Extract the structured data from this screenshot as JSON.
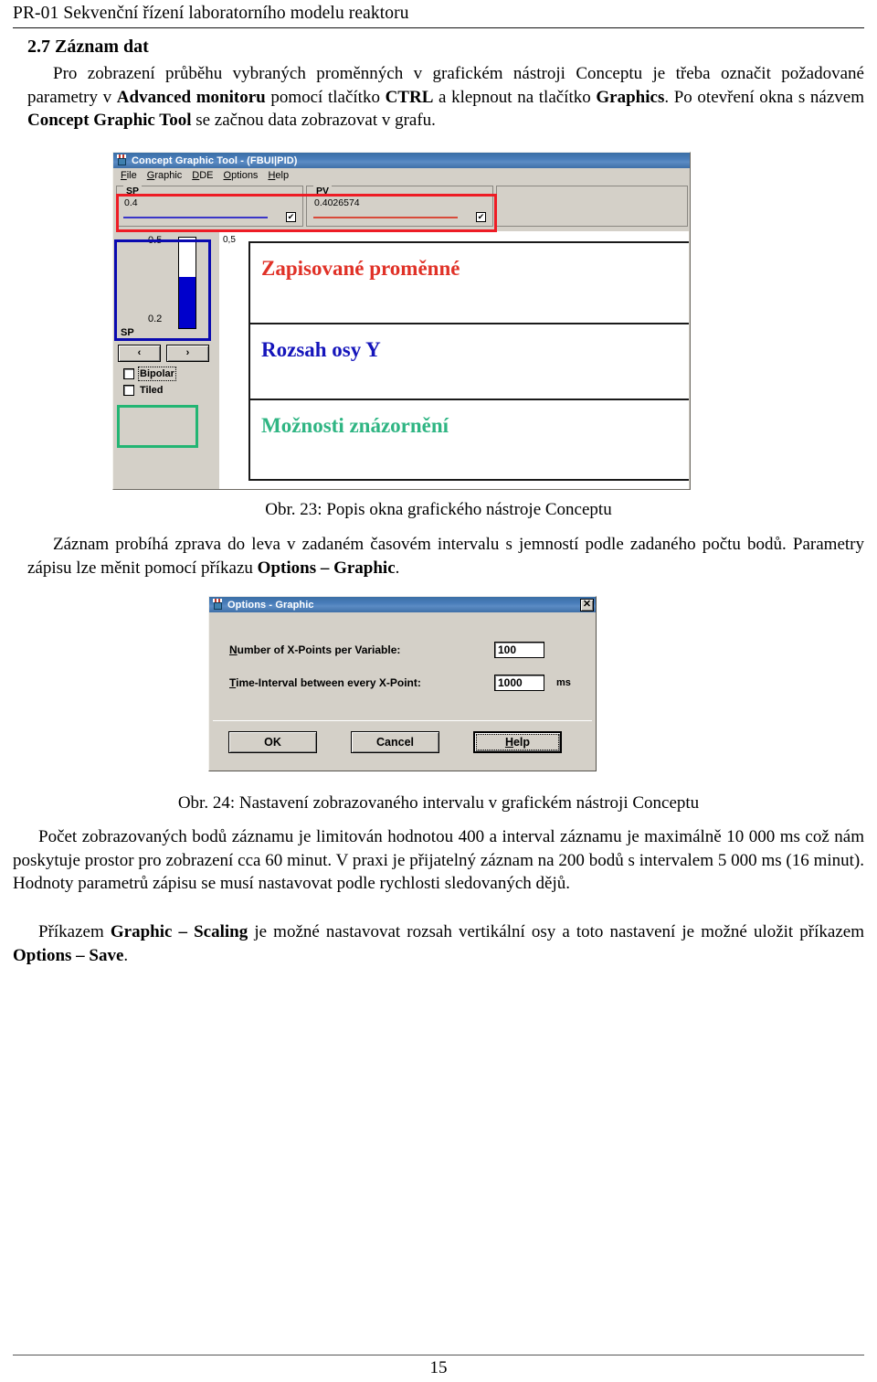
{
  "document": {
    "running_header": "PR-01 Sekvenční řízení laboratorního modelu reaktoru",
    "page_number": "15",
    "section_number_title": "2.7 Záznam dat"
  },
  "paragraphs": {
    "p1_part1": "Pro zobrazení průběhu vybraných proměnných v grafickém nástroji Conceptu je třeba označit požadované parametry v ",
    "p1_b1": "Advanced monitoru",
    "p1_part2": " pomocí tlačítko ",
    "p1_b2": "CTRL",
    "p1_part3": " a klepnout na tlačítko ",
    "p1_b3": "Graphics",
    "p1_part4": ". Po otevření okna s názvem ",
    "p1_b4": "Concept Graphic Tool",
    "p1_part5": " se začnou data zobrazovat v grafu.",
    "p2_part1": "Záznam probíhá zprava do leva v zadaném časovém intervalu s jemností podle zadaného počtu bodů. Parametry zápisu lze měnit pomocí příkazu ",
    "p2_b1": "Options – Graphic",
    "p2_part2": ".",
    "p3_text": "Počet zobrazovaných bodů záznamu je limitován hodnotou 400 a interval záznamu je maximálně 10 000 ms což nám poskytuje prostor pro zobrazení cca 60 minut. V praxi je přijatelný záznam na 200 bodů s intervalem 5 000 ms (16 minut). Hodnoty parametrů zápisu se musí nastavovat podle rychlosti sledovaných dějů.",
    "p4_part1": "Příkazem ",
    "p4_b1": "Graphic – Scaling",
    "p4_part2": " je možné nastavovat rozsah vertikální osy a toto nastavení je možné uložit příkazem ",
    "p4_b2": "Options – Save",
    "p4_part3": "."
  },
  "captions": {
    "fig23": "Obr. 23: Popis okna grafického nástroje Conceptu",
    "fig24": "Obr. 24: Nastavení zobrazovaného intervalu v grafickém nástroji Conceptu"
  },
  "concept_window": {
    "title": "Concept Graphic Tool - (FBUI|PID)",
    "icon": "graphic-tool-icon",
    "menu": [
      {
        "label": "File",
        "accel": "F"
      },
      {
        "label": "Graphic",
        "accel": "G"
      },
      {
        "label": "DDE",
        "accel": "D"
      },
      {
        "label": "Options",
        "accel": "O"
      },
      {
        "label": "Help",
        "accel": "H"
      }
    ],
    "variables": [
      {
        "name": "SP",
        "value": "0.4",
        "color": "#3a36c8",
        "checked": "✔"
      },
      {
        "name": "PV",
        "value": "0.4026574",
        "color": "#d84a3a",
        "checked": "✔"
      }
    ],
    "scale": {
      "max_label": "0.5",
      "min_label": "0.2",
      "channel_label": "SP",
      "fill_percent": 57
    },
    "arrow_buttons": {
      "prev": "‹",
      "next": "›"
    },
    "checkboxes": [
      {
        "label": "Bipolar",
        "checked": false
      },
      {
        "label": "Tiled",
        "checked": false
      }
    ],
    "plot": {
      "y_axis_top_label": "0,5",
      "annotations": [
        {
          "text": "Zapisované proměnné",
          "color": "#e03127"
        },
        {
          "text": "Rozsah osy Y",
          "color": "#1515bb"
        },
        {
          "text": "Možnosti znázornění",
          "color": "#2fb583"
        }
      ]
    }
  },
  "annotation_boxes": [
    {
      "name": "variables-highlight",
      "color": "#ee1c25"
    },
    {
      "name": "y-range-highlight",
      "color": "#0a0ab0"
    },
    {
      "name": "display-options-highlight",
      "color": "#22b573"
    }
  ],
  "options_dialog": {
    "title": "Options - Graphic",
    "icon": "graphic-tool-icon",
    "close_label": "✕",
    "fields": [
      {
        "label_prefix": "N",
        "label_rest": "umber of X-Points per Variable:",
        "value": "100",
        "unit": ""
      },
      {
        "label_prefix": "T",
        "label_rest": "ime-Interval between every X-Point:",
        "value": "1000",
        "unit": "ms"
      }
    ],
    "buttons": [
      {
        "label": "OK",
        "default": false
      },
      {
        "label": "Cancel",
        "default": false
      },
      {
        "label": "Help",
        "default": true,
        "accel": "H"
      }
    ]
  }
}
